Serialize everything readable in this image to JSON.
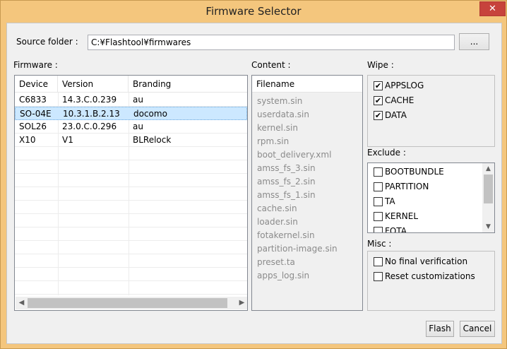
{
  "window": {
    "title": "Firmware Selector",
    "close_glyph": "✕"
  },
  "source": {
    "label": "Source folder :",
    "value": "C:¥Flashtool¥firmwares",
    "browse_label": "..."
  },
  "firmware": {
    "label": "Firmware :",
    "columns": [
      "Device",
      "Version",
      "Branding"
    ],
    "rows": [
      {
        "device": "C6833",
        "version": "14.3.C.0.239",
        "branding": "au"
      },
      {
        "device": "SO-04E",
        "version": "10.3.1.B.2.13",
        "branding": "docomo"
      },
      {
        "device": "SOL26",
        "version": "23.0.C.0.296",
        "branding": "au"
      },
      {
        "device": "X10",
        "version": "V1",
        "branding": "BLRelock"
      }
    ],
    "selected_index": 1
  },
  "content": {
    "label": "Content :",
    "header": "Filename",
    "files": [
      "system.sin",
      "userdata.sin",
      "kernel.sin",
      "rpm.sin",
      "boot_delivery.xml",
      "amss_fs_3.sin",
      "amss_fs_2.sin",
      "amss_fs_1.sin",
      "cache.sin",
      "loader.sin",
      "fotakernel.sin",
      "partition-image.sin",
      "preset.ta",
      "apps_log.sin"
    ]
  },
  "wipe": {
    "label": "Wipe :",
    "items": [
      {
        "label": "APPSLOG",
        "checked": true
      },
      {
        "label": "CACHE",
        "checked": true
      },
      {
        "label": "DATA",
        "checked": true
      }
    ]
  },
  "exclude": {
    "label": "Exclude :",
    "items": [
      {
        "label": "BOOTBUNDLE",
        "checked": false
      },
      {
        "label": "PARTITION",
        "checked": false
      },
      {
        "label": "TA",
        "checked": false
      },
      {
        "label": "KERNEL",
        "checked": false
      },
      {
        "label": "FOTA",
        "checked": false
      }
    ]
  },
  "misc": {
    "label": "Misc :",
    "items": [
      {
        "label": "No final verification",
        "checked": false
      },
      {
        "label": "Reset customizations",
        "checked": false
      }
    ]
  },
  "actions": {
    "flash_label": "Flash",
    "cancel_label": "Cancel"
  },
  "colors": {
    "titlebar": "#f4c67d",
    "close": "#c7433c",
    "selection": "#cce8ff",
    "disabled_text": "#8b8b8b"
  }
}
